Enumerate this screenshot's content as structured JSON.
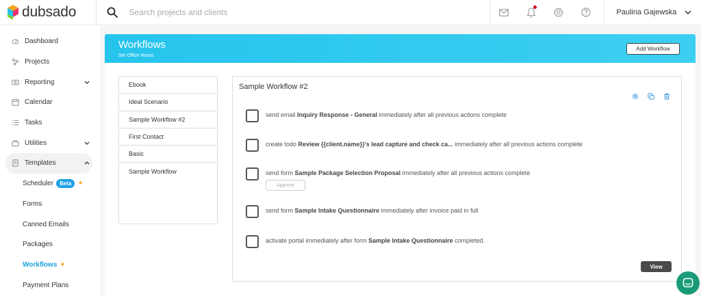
{
  "brand": {
    "name": "dubsado"
  },
  "search": {
    "placeholder": "Search projects and clients"
  },
  "user": {
    "name": "Paulina Gajewska"
  },
  "sidebar": {
    "items": [
      {
        "label": "Dashboard",
        "icon": "dashboard-icon"
      },
      {
        "label": "Projects",
        "icon": "projects-icon"
      },
      {
        "label": "Reporting",
        "icon": "reporting-icon"
      },
      {
        "label": "Calendar",
        "icon": "calendar-icon"
      },
      {
        "label": "Tasks",
        "icon": "tasks-icon"
      },
      {
        "label": "Utilities",
        "icon": "utilities-icon"
      },
      {
        "label": "Templates",
        "icon": "templates-icon"
      }
    ],
    "sub_items": [
      {
        "label": "Scheduler",
        "badge": "Beta"
      },
      {
        "label": "Forms"
      },
      {
        "label": "Canned Emails"
      },
      {
        "label": "Packages"
      },
      {
        "label": "Workflows"
      },
      {
        "label": "Payment Plans"
      }
    ]
  },
  "header": {
    "title": "Workflows",
    "subtitle": "Set Office Hours",
    "add_button": "Add Workflow"
  },
  "workflows": [
    "Ebook",
    "Ideal Scenario",
    "Sample Workflow #2",
    "First Contact",
    "Basic",
    "Sample Workflow"
  ],
  "detail": {
    "title": "Sample Workflow #2",
    "steps": [
      {
        "pre": "send email ",
        "bold": "Inquiry Response - General",
        "post": " immediately after all previous actions complete"
      },
      {
        "pre": "create todo ",
        "bold": "Review {{client.name}}'s lead capture and check ca...",
        "post": " immediately after all previous actions complete"
      },
      {
        "pre": "send form ",
        "bold": "Sample Package Selection Proposal",
        "post": " immediately after all previous actions complete"
      },
      {
        "pre": "send form ",
        "bold": "Sample Intake Questionnaire",
        "post": " immediately after invoice paid in full"
      },
      {
        "pre": "activate portal immediately after form ",
        "bold": "Sample Intake Questionnaire",
        "post": " completed."
      }
    ],
    "approve_label": "Approve",
    "view_label": "View"
  },
  "colors": {
    "accent": "#26c4ec",
    "active_link": "#1aa3d9",
    "badge": "#1ea1e8",
    "notification": "#d0021b",
    "chat": "#1a9b78"
  }
}
